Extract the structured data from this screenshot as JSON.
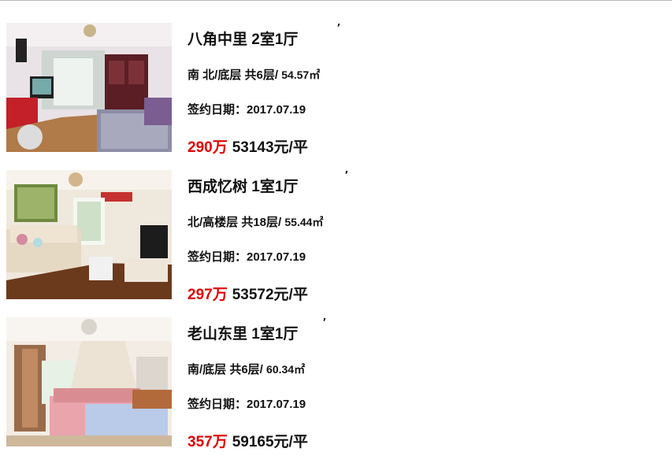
{
  "listings": [
    {
      "title": "八角中里 2室1厅",
      "tick": "′",
      "orientation_floor": "南 北/底层 共6层/",
      "area": "54.57㎡",
      "deal_date": "签约日期：2017.07.19",
      "total_price": "290万",
      "unit_price": "53143元/平",
      "photo_icon": "living-room-photo"
    },
    {
      "title": "西成忆树 1室1厅",
      "tick": "′",
      "orientation_floor": "北/高楼层 共18层/",
      "area": "55.44㎡",
      "deal_date": "签约日期：2017.07.19",
      "total_price": "297万",
      "unit_price": "53572元/平",
      "photo_icon": "living-room-photo"
    },
    {
      "title": "老山东里 1室1厅",
      "tick": "′",
      "orientation_floor": "南/底层 共6层/",
      "area": "60.34㎡",
      "deal_date": "签约日期：2017.07.19",
      "total_price": "357万",
      "unit_price": "59165元/平",
      "photo_icon": "bedroom-photo"
    }
  ],
  "colors": {
    "price_red": "#e10000",
    "text": "#111111"
  }
}
